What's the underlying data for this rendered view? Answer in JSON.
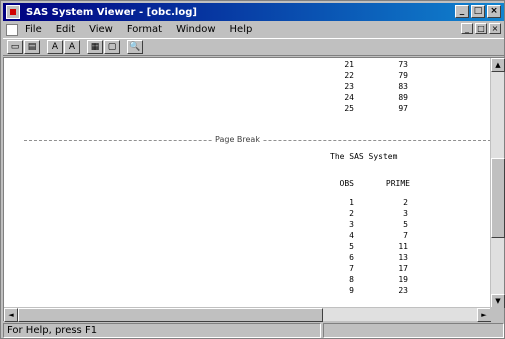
{
  "window": {
    "title": "SAS System Viewer - [obc.log]",
    "title_buttons": [
      "_",
      "□",
      "×"
    ],
    "menu_buttons": [
      "_",
      "□",
      "×"
    ]
  },
  "menu": {
    "items": [
      "File",
      "Edit",
      "View",
      "Format",
      "Window",
      "Help"
    ]
  },
  "toolbar": {
    "tools": [
      "open-icon",
      "save-icon",
      "font-a-icon",
      "font-b-icon",
      "grid-icon",
      "copy-icon",
      "find-icon"
    ],
    "tool_glyphs": [
      "▭",
      "▤",
      "A",
      "A",
      "▦",
      "▢",
      "🔍"
    ]
  },
  "output": {
    "top_rows": [
      {
        "obs": "21",
        "prime": "73"
      },
      {
        "obs": "22",
        "prime": "79"
      },
      {
        "obs": "23",
        "prime": "83"
      },
      {
        "obs": "24",
        "prime": "89"
      },
      {
        "obs": "25",
        "prime": "97"
      }
    ],
    "page_break_label": "Page Break",
    "system_title": "The SAS System",
    "header_obs": "OBS",
    "header_prime": "PRIME",
    "bottom_rows": [
      {
        "obs": "1",
        "prime": "2"
      },
      {
        "obs": "2",
        "prime": "3"
      },
      {
        "obs": "3",
        "prime": "5"
      },
      {
        "obs": "4",
        "prime": "7"
      },
      {
        "obs": "5",
        "prime": "11"
      },
      {
        "obs": "6",
        "prime": "13"
      },
      {
        "obs": "7",
        "prime": "17"
      },
      {
        "obs": "8",
        "prime": "19"
      },
      {
        "obs": "9",
        "prime": "23"
      }
    ]
  },
  "scroll": {
    "up": "▲",
    "down": "▼",
    "left": "◄",
    "right": "►"
  },
  "status": {
    "text": "For Help, press F1"
  }
}
